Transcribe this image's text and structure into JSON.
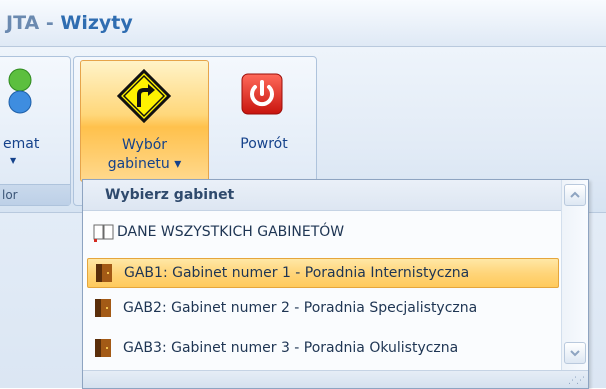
{
  "titlebar": {
    "prefix": "JTA",
    "separator": " - ",
    "name": "Wizyty"
  },
  "ribbon": {
    "left_button": {
      "label": "emat",
      "arrow": "▼"
    },
    "left_group_label": "lor",
    "wybor_button": {
      "line1": "Wybór",
      "line2": "gabinetu ▾"
    },
    "powrot_button": {
      "label": "Powrót"
    }
  },
  "dropdown": {
    "header": "Wybierz gabinet",
    "items": [
      {
        "label": "DANE WSZYSTKICH GABINETÓW",
        "icon": "open-book-icon",
        "selected": false
      },
      {
        "label": "GAB1: Gabinet numer 1 - Poradnia Internistyczna",
        "icon": "door-icon",
        "selected": true
      },
      {
        "label": "GAB2: Gabinet  numer 2 - Poradnia Specjalistyczna",
        "icon": "door-icon",
        "selected": false
      },
      {
        "label": "GAB3: Gabinet numer 3 - Poradnia Okulistyczna",
        "icon": "door-icon",
        "selected": false
      }
    ]
  },
  "colors": {
    "accent": "#2f6db1",
    "selected": "#ffd57a",
    "ribbon_text": "#15428b"
  }
}
